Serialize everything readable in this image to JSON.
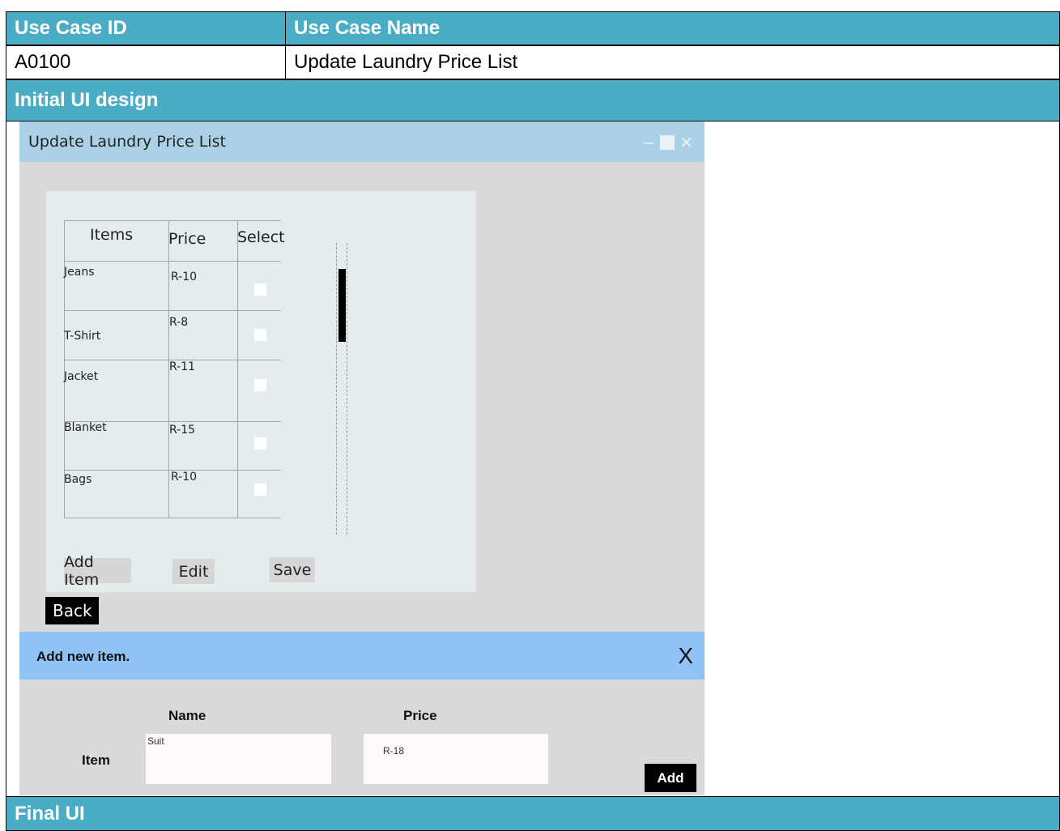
{
  "table": {
    "col1_header": "Use Case ID",
    "col2_header": "Use Case Name",
    "use_case_id": "A0100",
    "use_case_name": "Update Laundry Price List",
    "section_initial": "Initial UI design",
    "section_final": "Final UI",
    "header_color": "#4bacc6"
  },
  "window": {
    "title": "Update Laundry Price List",
    "columns": {
      "items": "Items",
      "price": "Price",
      "select": "Select"
    },
    "rows": [
      {
        "item": "Jeans",
        "price": "R-10"
      },
      {
        "item": "T-Shirt",
        "price": "R-8"
      },
      {
        "item": "Jacket",
        "price": "R-11"
      },
      {
        "item": "Blanket",
        "price": "R-15"
      },
      {
        "item": "Bags",
        "price": "R-10"
      }
    ],
    "buttons": {
      "add_item": "Add Item",
      "edit": "Edit",
      "save": "Save",
      "back": "Back"
    },
    "icons": [
      "minimize-icon",
      "maximize-icon",
      "close-icon"
    ]
  },
  "dialog": {
    "title": "Add new item.",
    "close_glyph": "X",
    "name_label": "Name",
    "price_label": "Price",
    "row_label": "Item",
    "name_value": "Suit",
    "price_value": "R-18",
    "add_button": "Add"
  }
}
